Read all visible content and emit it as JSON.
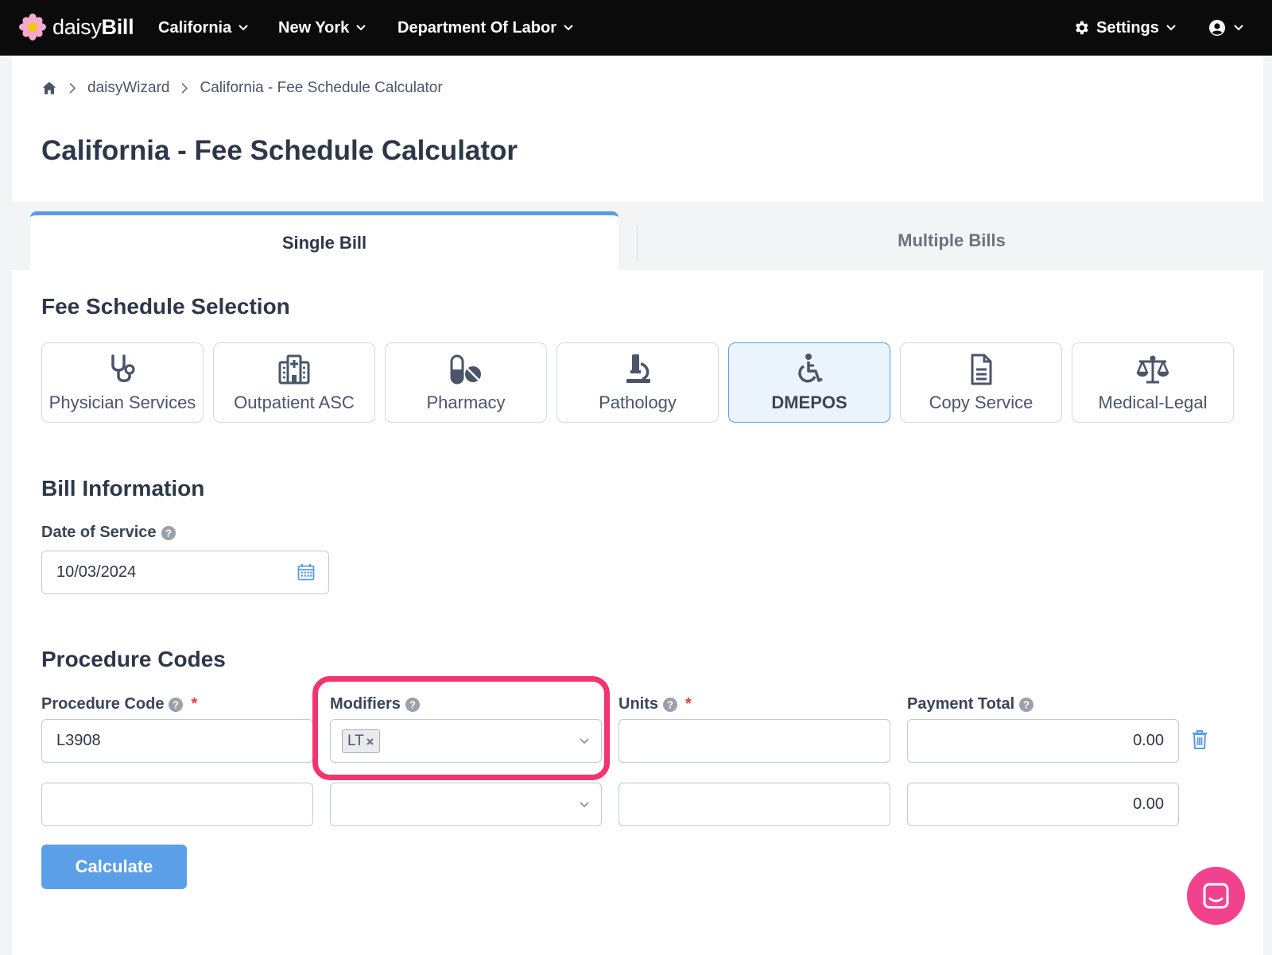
{
  "brand": {
    "name_light": "daisy",
    "name_bold": "Bill"
  },
  "nav": {
    "items": [
      {
        "label": "California"
      },
      {
        "label": "New York"
      },
      {
        "label": "Department Of Labor"
      }
    ],
    "settings_label": "Settings"
  },
  "breadcrumb": {
    "items": [
      "daisyWizard",
      "California - Fee Schedule Calculator"
    ]
  },
  "page": {
    "title": "California - Fee Schedule Calculator"
  },
  "tabs": [
    {
      "label": "Single Bill",
      "active": true
    },
    {
      "label": "Multiple Bills",
      "active": false
    }
  ],
  "fee_schedule": {
    "title": "Fee Schedule Selection",
    "options": [
      {
        "label": "Physician Services",
        "icon": "stethoscope-icon"
      },
      {
        "label": "Outpatient ASC",
        "icon": "hospital-icon"
      },
      {
        "label": "Pharmacy",
        "icon": "pills-icon"
      },
      {
        "label": "Pathology",
        "icon": "microscope-icon"
      },
      {
        "label": "DMEPOS",
        "icon": "wheelchair-icon",
        "selected": true
      },
      {
        "label": "Copy Service",
        "icon": "document-icon"
      },
      {
        "label": "Medical-Legal",
        "icon": "balance-scale-icon"
      }
    ]
  },
  "bill_info": {
    "title": "Bill Information",
    "date_label": "Date of Service",
    "date_value": "10/03/2024"
  },
  "procedure_codes": {
    "title": "Procedure Codes",
    "headers": {
      "code": "Procedure Code",
      "modifiers": "Modifiers",
      "units": "Units",
      "payment": "Payment Total"
    },
    "required_mark": "*",
    "rows": [
      {
        "code": "L3908",
        "modifiers": [
          "LT"
        ],
        "units": "",
        "payment": "0.00"
      },
      {
        "code": "",
        "modifiers": [],
        "units": "",
        "payment": "0.00"
      }
    ]
  },
  "actions": {
    "calculate_label": "Calculate"
  },
  "colors": {
    "nav_bg": "#0b0b0b",
    "accent_blue": "#5b9fe9",
    "selected_bg": "#ebf4fd",
    "highlight_pink": "#f5336e",
    "chat_pink": "#f2428f",
    "required_red": "#e53e3e"
  }
}
